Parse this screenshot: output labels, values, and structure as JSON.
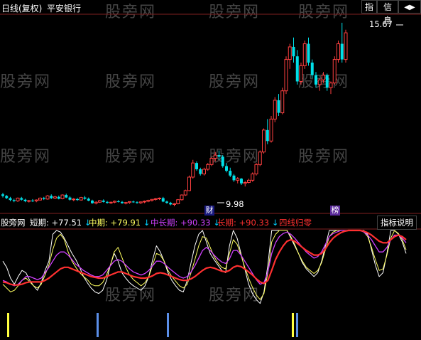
{
  "header": {
    "period": "日线(复权)",
    "stock_name": "平安银行",
    "btn_index": "指",
    "btn_info": "信息",
    "btn_nav": "◀▶"
  },
  "price_panel": {
    "high_label": "15.67",
    "low_label": "9.98",
    "badge_cai": "财",
    "badge_bang": "榜",
    "up_color": "#ff4040",
    "down_color": "#00e0e8"
  },
  "indicator_panel": {
    "name": "股旁网",
    "short": {
      "label": "短期",
      "value": "+77.51",
      "arrow": "↓",
      "color": "#ffffff"
    },
    "mid": {
      "label": "中期",
      "value": "+79.91",
      "arrow": "↓",
      "color": "#ffff60"
    },
    "midlong": {
      "label": "中长期",
      "value": "+90.33",
      "arrow": "↓",
      "color": "#d040ff"
    },
    "long": {
      "label": "长期",
      "value": "+90.33",
      "arrow": "↓",
      "color": "#ff3030"
    },
    "zero": {
      "label": "四线归零",
      "color": "#ff3030"
    },
    "help_button": "指标说明"
  },
  "watermarks": [
    "股旁网",
    "股旁网",
    "股旁网",
    "股旁网",
    "股旁网",
    "股旁网",
    "股旁网",
    "股旁网",
    "股旁网",
    "股旁网",
    "股旁网",
    "股旁网",
    "股旁网"
  ],
  "chart_data": [
    {
      "type": "candlestick",
      "series": [
        {
          "name": "平安银行",
          "values": [
            [
              10.2,
              10.25,
              10.1,
              10.15
            ],
            [
              10.15,
              10.18,
              10.05,
              10.08
            ],
            [
              10.08,
              10.12,
              9.98,
              10.02
            ],
            [
              10.02,
              10.06,
              9.95,
              9.99
            ],
            [
              9.99,
              10.1,
              9.96,
              10.08
            ],
            [
              10.08,
              10.12,
              10.0,
              10.03
            ],
            [
              10.03,
              10.06,
              9.95,
              9.98
            ],
            [
              9.98,
              10.02,
              9.94,
              10.0
            ],
            [
              10.0,
              10.05,
              9.96,
              9.99
            ],
            [
              9.99,
              10.04,
              9.95,
              10.02
            ],
            [
              10.02,
              10.1,
              10.0,
              10.08
            ],
            [
              10.08,
              10.12,
              10.02,
              10.05
            ],
            [
              10.05,
              10.18,
              10.03,
              10.15
            ],
            [
              10.15,
              10.2,
              10.05,
              10.08
            ],
            [
              10.08,
              10.15,
              10.05,
              10.12
            ],
            [
              10.12,
              10.16,
              10.04,
              10.06
            ],
            [
              10.06,
              10.2,
              10.04,
              10.18
            ],
            [
              10.18,
              10.22,
              10.08,
              10.1
            ],
            [
              10.1,
              10.14,
              10.0,
              10.03
            ],
            [
              10.03,
              10.08,
              9.98,
              10.05
            ],
            [
              10.05,
              10.09,
              9.99,
              10.02
            ],
            [
              10.02,
              10.12,
              10.0,
              10.1
            ],
            [
              10.1,
              10.15,
              10.03,
              10.06
            ],
            [
              10.06,
              10.1,
              9.98,
              10.0
            ],
            [
              10.0,
              10.03,
              9.9,
              9.92
            ],
            [
              9.92,
              9.98,
              9.88,
              9.95
            ],
            [
              9.95,
              10.02,
              9.93,
              10.0
            ],
            [
              10.0,
              10.04,
              9.94,
              9.96
            ],
            [
              9.96,
              9.99,
              9.9,
              9.93
            ],
            [
              9.93,
              9.97,
              9.89,
              9.95
            ],
            [
              9.95,
              10.0,
              9.92,
              9.98
            ],
            [
              9.98,
              10.02,
              9.94,
              9.96
            ],
            [
              9.96,
              9.99,
              9.9,
              9.92
            ],
            [
              9.92,
              9.96,
              9.88,
              9.94
            ],
            [
              9.94,
              9.98,
              9.9,
              9.97
            ],
            [
              9.97,
              10.0,
              9.93,
              9.95
            ],
            [
              9.95,
              9.98,
              9.9,
              9.93
            ],
            [
              9.93,
              9.97,
              9.89,
              9.96
            ],
            [
              9.96,
              10.0,
              9.92,
              9.98
            ],
            [
              9.98,
              10.03,
              9.95,
              10.01
            ],
            [
              10.01,
              10.05,
              9.97,
              10.04
            ],
            [
              10.04,
              10.08,
              10.0,
              10.06
            ],
            [
              10.06,
              10.1,
              10.02,
              10.08
            ],
            [
              10.08,
              10.12,
              9.95,
              9.97
            ],
            [
              9.97,
              10.0,
              9.9,
              9.93
            ],
            [
              9.93,
              9.96,
              9.85,
              9.88
            ],
            [
              9.88,
              9.92,
              9.82,
              9.9
            ],
            [
              9.9,
              10.05,
              9.88,
              10.03
            ],
            [
              10.03,
              10.2,
              10.0,
              10.18
            ],
            [
              10.18,
              10.35,
              10.15,
              10.32
            ],
            [
              10.32,
              10.8,
              10.3,
              10.75
            ],
            [
              10.75,
              11.3,
              10.7,
              11.2
            ],
            [
              11.2,
              11.25,
              10.95,
              11.0
            ],
            [
              11.0,
              11.05,
              10.8,
              10.85
            ],
            [
              10.85,
              11.05,
              10.8,
              11.0
            ],
            [
              11.0,
              11.2,
              10.95,
              11.15
            ],
            [
              11.15,
              11.4,
              11.1,
              11.35
            ],
            [
              11.35,
              11.55,
              11.25,
              11.45
            ],
            [
              11.45,
              11.6,
              11.3,
              11.4
            ],
            [
              11.4,
              11.45,
              11.05,
              11.1
            ],
            [
              11.1,
              11.2,
              10.9,
              10.95
            ],
            [
              10.95,
              11.05,
              10.75,
              10.8
            ],
            [
              10.8,
              10.85,
              10.6,
              10.65
            ],
            [
              10.65,
              10.75,
              10.55,
              10.7
            ],
            [
              10.7,
              10.72,
              10.5,
              10.55
            ],
            [
              10.55,
              10.62,
              10.45,
              10.58
            ],
            [
              10.58,
              10.7,
              10.55,
              10.65
            ],
            [
              10.65,
              10.9,
              10.6,
              10.85
            ],
            [
              10.85,
              11.2,
              10.8,
              11.15
            ],
            [
              11.15,
              11.6,
              11.1,
              11.55
            ],
            [
              11.55,
              12.3,
              11.5,
              12.25
            ],
            [
              12.25,
              12.6,
              11.8,
              11.9
            ],
            [
              11.9,
              12.7,
              11.85,
              12.6
            ],
            [
              12.6,
              13.3,
              12.5,
              13.2
            ],
            [
              13.2,
              13.4,
              12.7,
              12.8
            ],
            [
              12.8,
              13.6,
              12.75,
              13.5
            ],
            [
              13.5,
              14.6,
              13.4,
              14.5
            ],
            [
              14.5,
              15.0,
              14.2,
              14.9
            ],
            [
              14.9,
              15.2,
              14.4,
              14.6
            ],
            [
              14.6,
              14.8,
              13.7,
              13.8
            ],
            [
              13.8,
              14.4,
              13.7,
              14.3
            ],
            [
              14.3,
              15.1,
              14.2,
              15.0
            ],
            [
              15.0,
              15.2,
              14.3,
              14.4
            ],
            [
              14.4,
              14.5,
              13.9,
              14.0
            ],
            [
              14.0,
              14.1,
              13.6,
              13.7
            ],
            [
              13.7,
              13.9,
              13.5,
              13.85
            ],
            [
              13.85,
              14.1,
              13.75,
              14.0
            ],
            [
              14.0,
              14.05,
              13.5,
              13.6
            ],
            [
              13.6,
              13.8,
              13.4,
              13.75
            ],
            [
              13.75,
              14.6,
              13.7,
              14.5
            ],
            [
              14.5,
              15.1,
              14.4,
              15.0
            ],
            [
              15.0,
              15.67,
              14.4,
              14.5
            ],
            [
              14.5,
              15.45,
              14.4,
              15.35
            ]
          ]
        }
      ],
      "annotations": [
        "15.67",
        "9.98",
        "财",
        "榜"
      ]
    },
    {
      "type": "line",
      "ylim": [
        0,
        100
      ],
      "series": [
        {
          "name": "短期",
          "values": [
            60,
            52,
            38,
            30,
            40,
            48,
            45,
            35,
            28,
            22,
            32,
            48,
            60,
            95,
            100,
            98,
            90,
            80,
            70,
            62,
            52,
            40,
            32,
            25,
            20,
            18,
            22,
            35,
            55,
            70,
            60,
            45,
            38,
            32,
            28,
            25,
            22,
            28,
            40,
            62,
            80,
            72,
            60,
            45,
            35,
            28,
            22,
            20,
            35,
            58,
            80,
            95,
            100,
            85,
            70,
            62,
            55,
            48,
            45,
            80,
            100,
            90,
            70,
            50,
            30,
            18,
            10,
            5,
            20,
            55,
            100,
            100,
            100,
            100,
            100,
            90,
            80,
            70,
            58,
            50,
            45,
            40,
            45,
            60,
            80,
            100,
            100,
            100,
            100,
            100,
            100,
            100,
            100,
            100,
            100,
            95,
            75,
            55,
            40,
            45,
            70,
            100,
            100,
            95,
            85,
            70
          ]
        },
        {
          "name": "中期",
          "values": [
            30,
            25,
            20,
            22,
            28,
            35,
            38,
            33,
            28,
            25,
            30,
            42,
            55,
            75,
            90,
            95,
            88,
            72,
            60,
            52,
            45,
            40,
            36,
            30,
            28,
            28,
            32,
            42,
            55,
            72,
            78,
            65,
            52,
            42,
            36,
            32,
            28,
            32,
            40,
            55,
            70,
            68,
            60,
            48,
            40,
            34,
            28,
            25,
            30,
            45,
            62,
            80,
            92,
            90,
            78,
            66,
            58,
            52,
            50,
            70,
            88,
            82,
            68,
            52,
            38,
            26,
            16,
            10,
            18,
            45,
            85,
            95,
            100,
            100,
            100,
            92,
            82,
            70,
            60,
            52,
            48,
            44,
            48,
            58,
            75,
            92,
            98,
            100,
            100,
            100,
            100,
            100,
            100,
            100,
            98,
            92,
            78,
            62,
            48,
            50,
            68,
            90,
            100,
            96,
            88,
            75
          ]
        },
        {
          "name": "中长期",
          "values": [
            35,
            33,
            30,
            28,
            30,
            35,
            40,
            40,
            38,
            36,
            38,
            45,
            52,
            60,
            68,
            72,
            72,
            68,
            62,
            56,
            52,
            48,
            45,
            42,
            40,
            40,
            42,
            48,
            54,
            60,
            62,
            60,
            55,
            50,
            46,
            44,
            42,
            44,
            48,
            54,
            60,
            60,
            57,
            52,
            48,
            44,
            40,
            38,
            40,
            46,
            54,
            64,
            74,
            78,
            74,
            68,
            63,
            59,
            57,
            63,
            74,
            74,
            68,
            60,
            52,
            44,
            36,
            30,
            32,
            46,
            70,
            84,
            92,
            96,
            98,
            95,
            90,
            84,
            78,
            72,
            68,
            64,
            66,
            72,
            82,
            92,
            96,
            98,
            100,
            100,
            100,
            100,
            100,
            100,
            98,
            94,
            88,
            80,
            72,
            72,
            78,
            88,
            94,
            94,
            90,
            84
          ]
        },
        {
          "name": "长期",
          "values": [
            33,
            32,
            30,
            29,
            29,
            30,
            32,
            33,
            33,
            33,
            33,
            35,
            38,
            42,
            46,
            50,
            52,
            52,
            50,
            48,
            46,
            44,
            42,
            40,
            39,
            38,
            38,
            40,
            42,
            44,
            46,
            46,
            44,
            42,
            40,
            39,
            38,
            38,
            39,
            41,
            44,
            45,
            44,
            42,
            40,
            38,
            36,
            35,
            35,
            37,
            40,
            44,
            48,
            51,
            52,
            51,
            49,
            47,
            46,
            48,
            52,
            54,
            53,
            50,
            46,
            42,
            37,
            33,
            31,
            35,
            48,
            62,
            72,
            80,
            86,
            88,
            86,
            82,
            78,
            74,
            71,
            68,
            68,
            70,
            76,
            84,
            90,
            94,
            97,
            99,
            100,
            100,
            100,
            100,
            99,
            97,
            94,
            90,
            86,
            84,
            84,
            88,
            92,
            94,
            92,
            88
          ]
        }
      ]
    }
  ]
}
